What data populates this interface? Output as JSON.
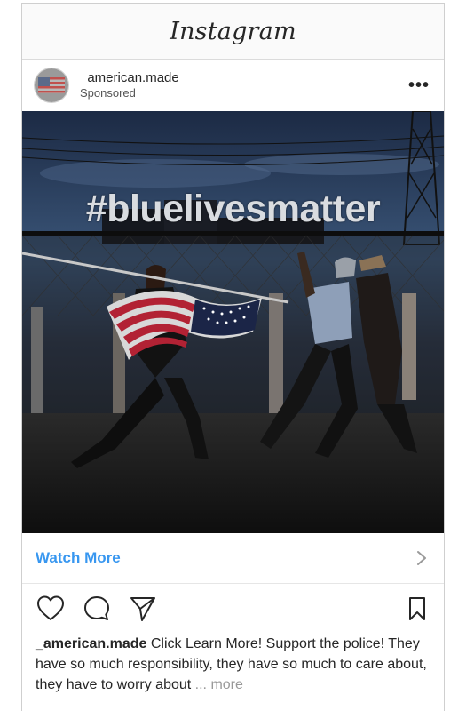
{
  "app": {
    "title": "Instagram"
  },
  "post": {
    "username": "_american.made",
    "sponsored_label": "Sponsored",
    "more_label": "•••",
    "image_overlay_text": "#bluelivesmatter",
    "cta_label": "Watch More",
    "caption_username": "_american.made",
    "caption_text": " Click Learn More! Support the police! They have so much responsibility, they have so much to care about, they have to worry about ",
    "caption_more": "... more"
  },
  "icons": {
    "like": "heart-icon",
    "comment": "comment-icon",
    "share": "send-icon",
    "save": "bookmark-icon",
    "cta_arrow": "chevron-right-icon"
  },
  "colors": {
    "link_blue": "#3897f0",
    "text": "#262626",
    "muted": "#999999"
  }
}
